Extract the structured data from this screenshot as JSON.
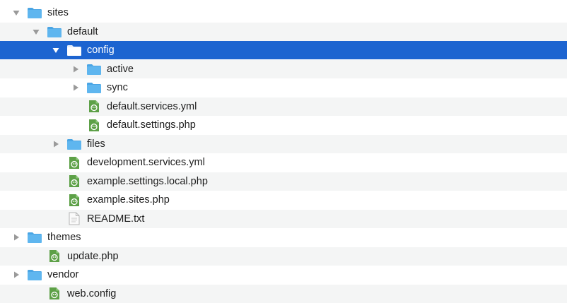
{
  "tree": {
    "items": [
      {
        "label": "sites",
        "icon": "folder-icon",
        "disclosure": "expanded",
        "level": 0
      },
      {
        "label": "default",
        "icon": "folder-icon",
        "disclosure": "expanded",
        "level": 1
      },
      {
        "label": "config",
        "icon": "folder-icon",
        "disclosure": "expanded",
        "level": 2,
        "selected": true
      },
      {
        "label": "active",
        "icon": "folder-icon",
        "disclosure": "collapsed",
        "level": 3
      },
      {
        "label": "sync",
        "icon": "folder-icon",
        "disclosure": "collapsed",
        "level": 3
      },
      {
        "label": "default.services.yml",
        "icon": "drupal-file-icon",
        "disclosure": "none",
        "level": 3
      },
      {
        "label": "default.settings.php",
        "icon": "drupal-file-icon",
        "disclosure": "none",
        "level": 3
      },
      {
        "label": "files",
        "icon": "folder-icon",
        "disclosure": "collapsed",
        "level": 2
      },
      {
        "label": "development.services.yml",
        "icon": "drupal-file-icon",
        "disclosure": "none",
        "level": 2
      },
      {
        "label": "example.settings.local.php",
        "icon": "drupal-file-icon",
        "disclosure": "none",
        "level": 2
      },
      {
        "label": "example.sites.php",
        "icon": "drupal-file-icon",
        "disclosure": "none",
        "level": 2
      },
      {
        "label": "README.txt",
        "icon": "text-file-icon",
        "disclosure": "none",
        "level": 2
      },
      {
        "label": "themes",
        "icon": "folder-icon",
        "disclosure": "collapsed",
        "level": 0
      },
      {
        "label": "update.php",
        "icon": "drupal-file-icon",
        "disclosure": "none",
        "level": 1
      },
      {
        "label": "vendor",
        "icon": "folder-icon",
        "disclosure": "collapsed",
        "level": 0
      },
      {
        "label": "web.config",
        "icon": "drupal-file-icon",
        "disclosure": "none",
        "level": 1
      }
    ]
  },
  "colors": {
    "selection": "#1c64d0",
    "folder": "#5fb6ef",
    "drupal_green": "#5da047",
    "alt_row": "#f4f5f5"
  }
}
